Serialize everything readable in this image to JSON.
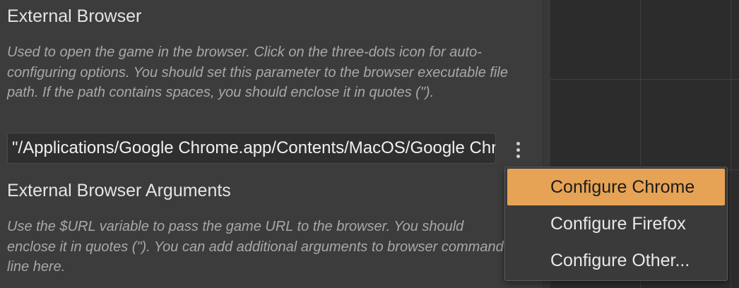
{
  "settings": {
    "external_browser": {
      "title": "External Browser",
      "description": "Used to open the game in the browser. Click on the three-dots icon for auto-configuring options. You should set this parameter to the browser executable file path. If the path contains spaces, you should enclose it in quotes (\").",
      "value": "\"/Applications/Google Chrome.app/Contents/MacOS/Google Chrome\""
    },
    "external_browser_arguments": {
      "title": "External Browser Arguments",
      "description": "Use the $URL variable to pass the game URL to the browser. You should enclose it in quotes (\"). You can add additional arguments to browser command line here."
    }
  },
  "options_button": {
    "icon": "three-dots-vertical-icon"
  },
  "menu": {
    "items": [
      {
        "label": "Configure Chrome",
        "active": true
      },
      {
        "label": "Configure Firefox",
        "active": false
      },
      {
        "label": "Configure Other...",
        "active": false
      }
    ]
  },
  "colors": {
    "panel_bg": "#3c3c3c",
    "accent": "#e6a355",
    "description_text": "#a8a8a8"
  }
}
